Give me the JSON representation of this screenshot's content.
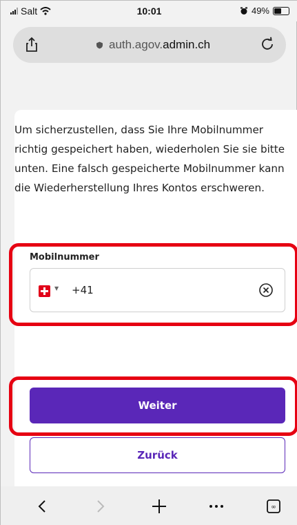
{
  "status_bar": {
    "carrier": "Salt",
    "time": "10:01",
    "battery_percent": "49%"
  },
  "browser": {
    "url_prefix": "auth.agov.",
    "url_domain": "admin.ch"
  },
  "page": {
    "instruction": "Um sicherzustellen, dass Sie Ihre Mobilnummer richtig gespeichert haben, wiederholen Sie sie bitte unten. Eine falsch gespeicherte Mobilnummer kann die Wiederherstellung Ihres Kontos erschweren.",
    "phone_field": {
      "label": "Mobilnummer",
      "value": "+41",
      "country_flag": "swiss-flag-icon"
    },
    "buttons": {
      "next_label": "Weiter",
      "back_label": "Zurück"
    }
  },
  "colors": {
    "primary": "#5a27b8",
    "highlight": "#e60012",
    "flag_red": "#e1001a"
  },
  "toolbar": {
    "icons": [
      "back-icon",
      "forward-icon",
      "new-tab-icon",
      "more-icon",
      "tabs-icon"
    ]
  }
}
